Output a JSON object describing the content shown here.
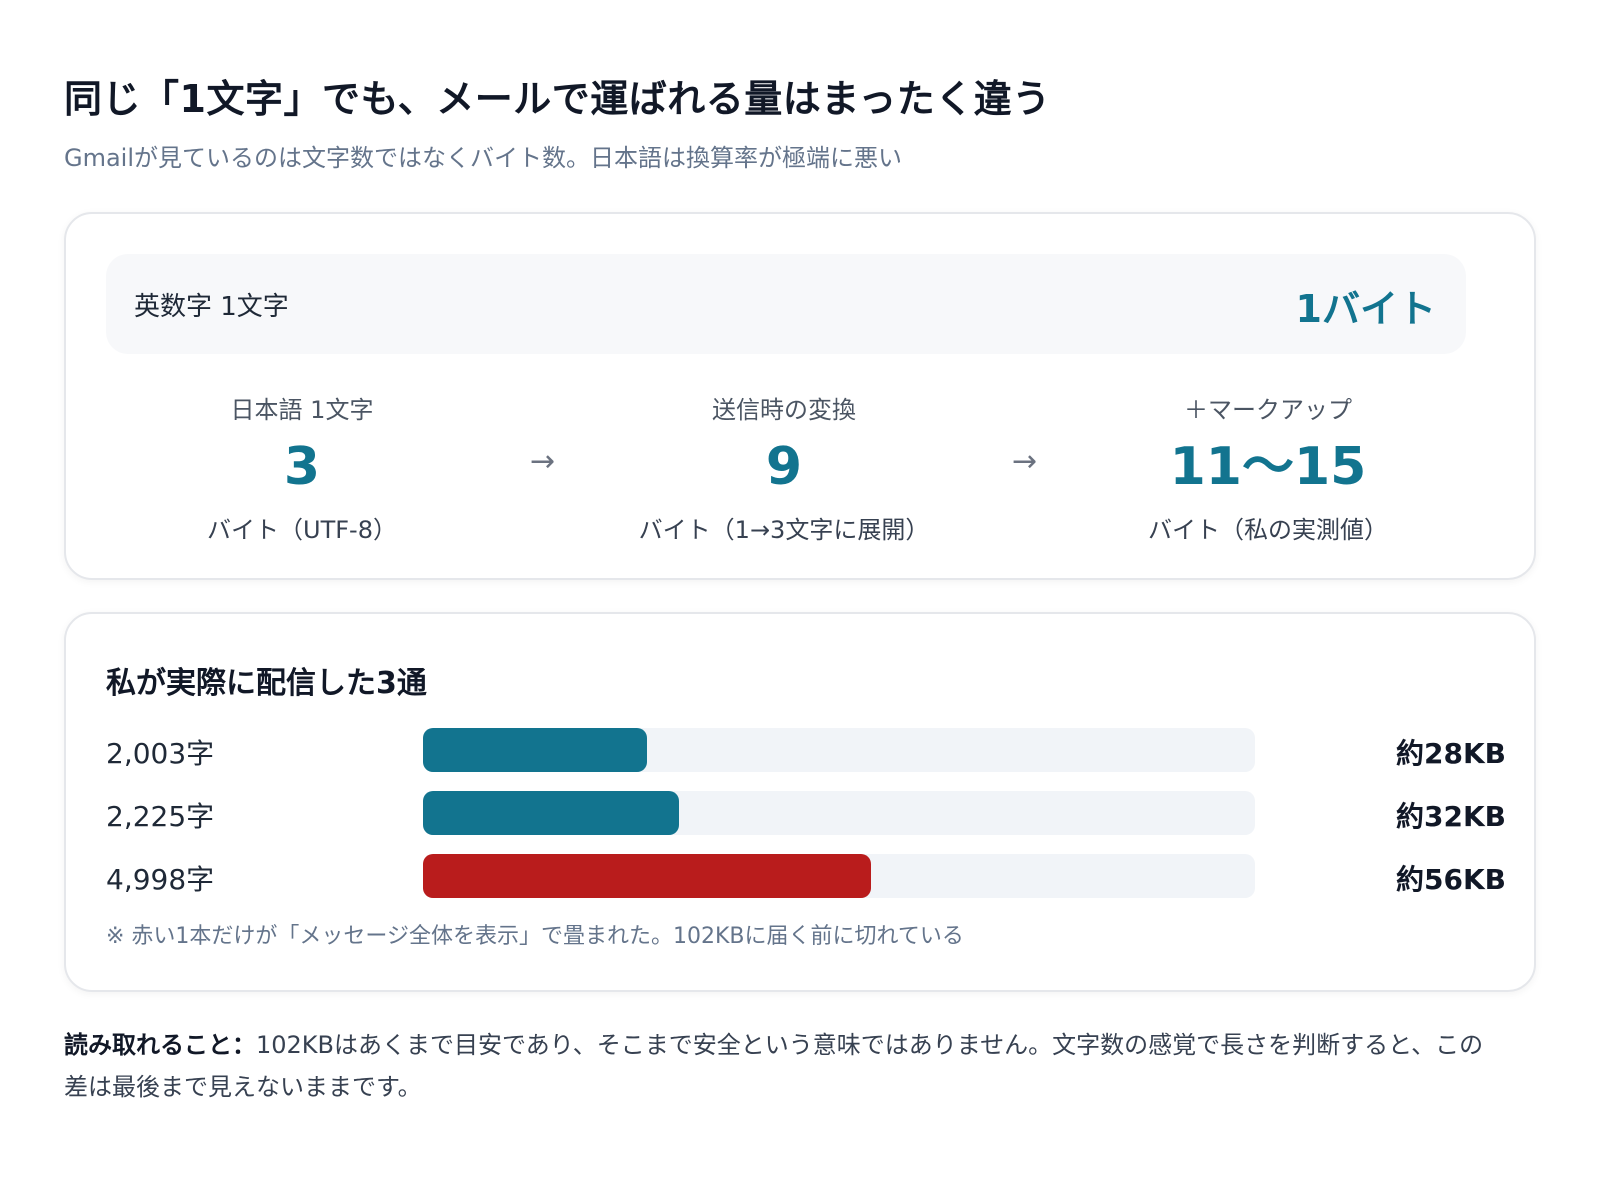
{
  "title": "同じ「1文字」でも、メールで運ばれる量はまったく違う",
  "subtitle": "Gmailが見ているのは文字数ではなくバイト数。日本語は換算率が極端に悪い",
  "bytes_card": {
    "ascii": {
      "label": "英数字 1文字",
      "value": "1バイト"
    },
    "steps": [
      {
        "label": "日本語 1文字",
        "value": "3",
        "sub": "バイト（UTF-8）"
      },
      {
        "label": "送信時の変換",
        "value": "9",
        "sub": "バイト（1→3文字に展開）"
      },
      {
        "label": "＋マークアップ",
        "value": "11〜15",
        "sub": "バイト（私の実測値）"
      }
    ],
    "arrow_glyph": "→"
  },
  "chart_data": {
    "type": "bar",
    "title": "私が実際に配信した3通",
    "categories": [
      "2,003字",
      "2,225字",
      "4,998字"
    ],
    "values": [
      28,
      32,
      56
    ],
    "value_labels": [
      "約28KB",
      "約32KB",
      "約56KB"
    ],
    "unit": "KB",
    "xlim": [
      0,
      104
    ],
    "colors": [
      "#12748f",
      "#12748f",
      "#b91c1c"
    ],
    "track_color": "#f1f4f8",
    "note": "※ 赤い1本だけが「メッセージ全体を表示」で畳まれた。102KBに届く前に切れている"
  },
  "takeaway": {
    "lead": "読み取れること：",
    "body": "102KBはあくまで目安であり、そこまで安全という意味ではありません。文字数の感覚で長さを判断すると、この差は最後まで見えないままです。"
  }
}
